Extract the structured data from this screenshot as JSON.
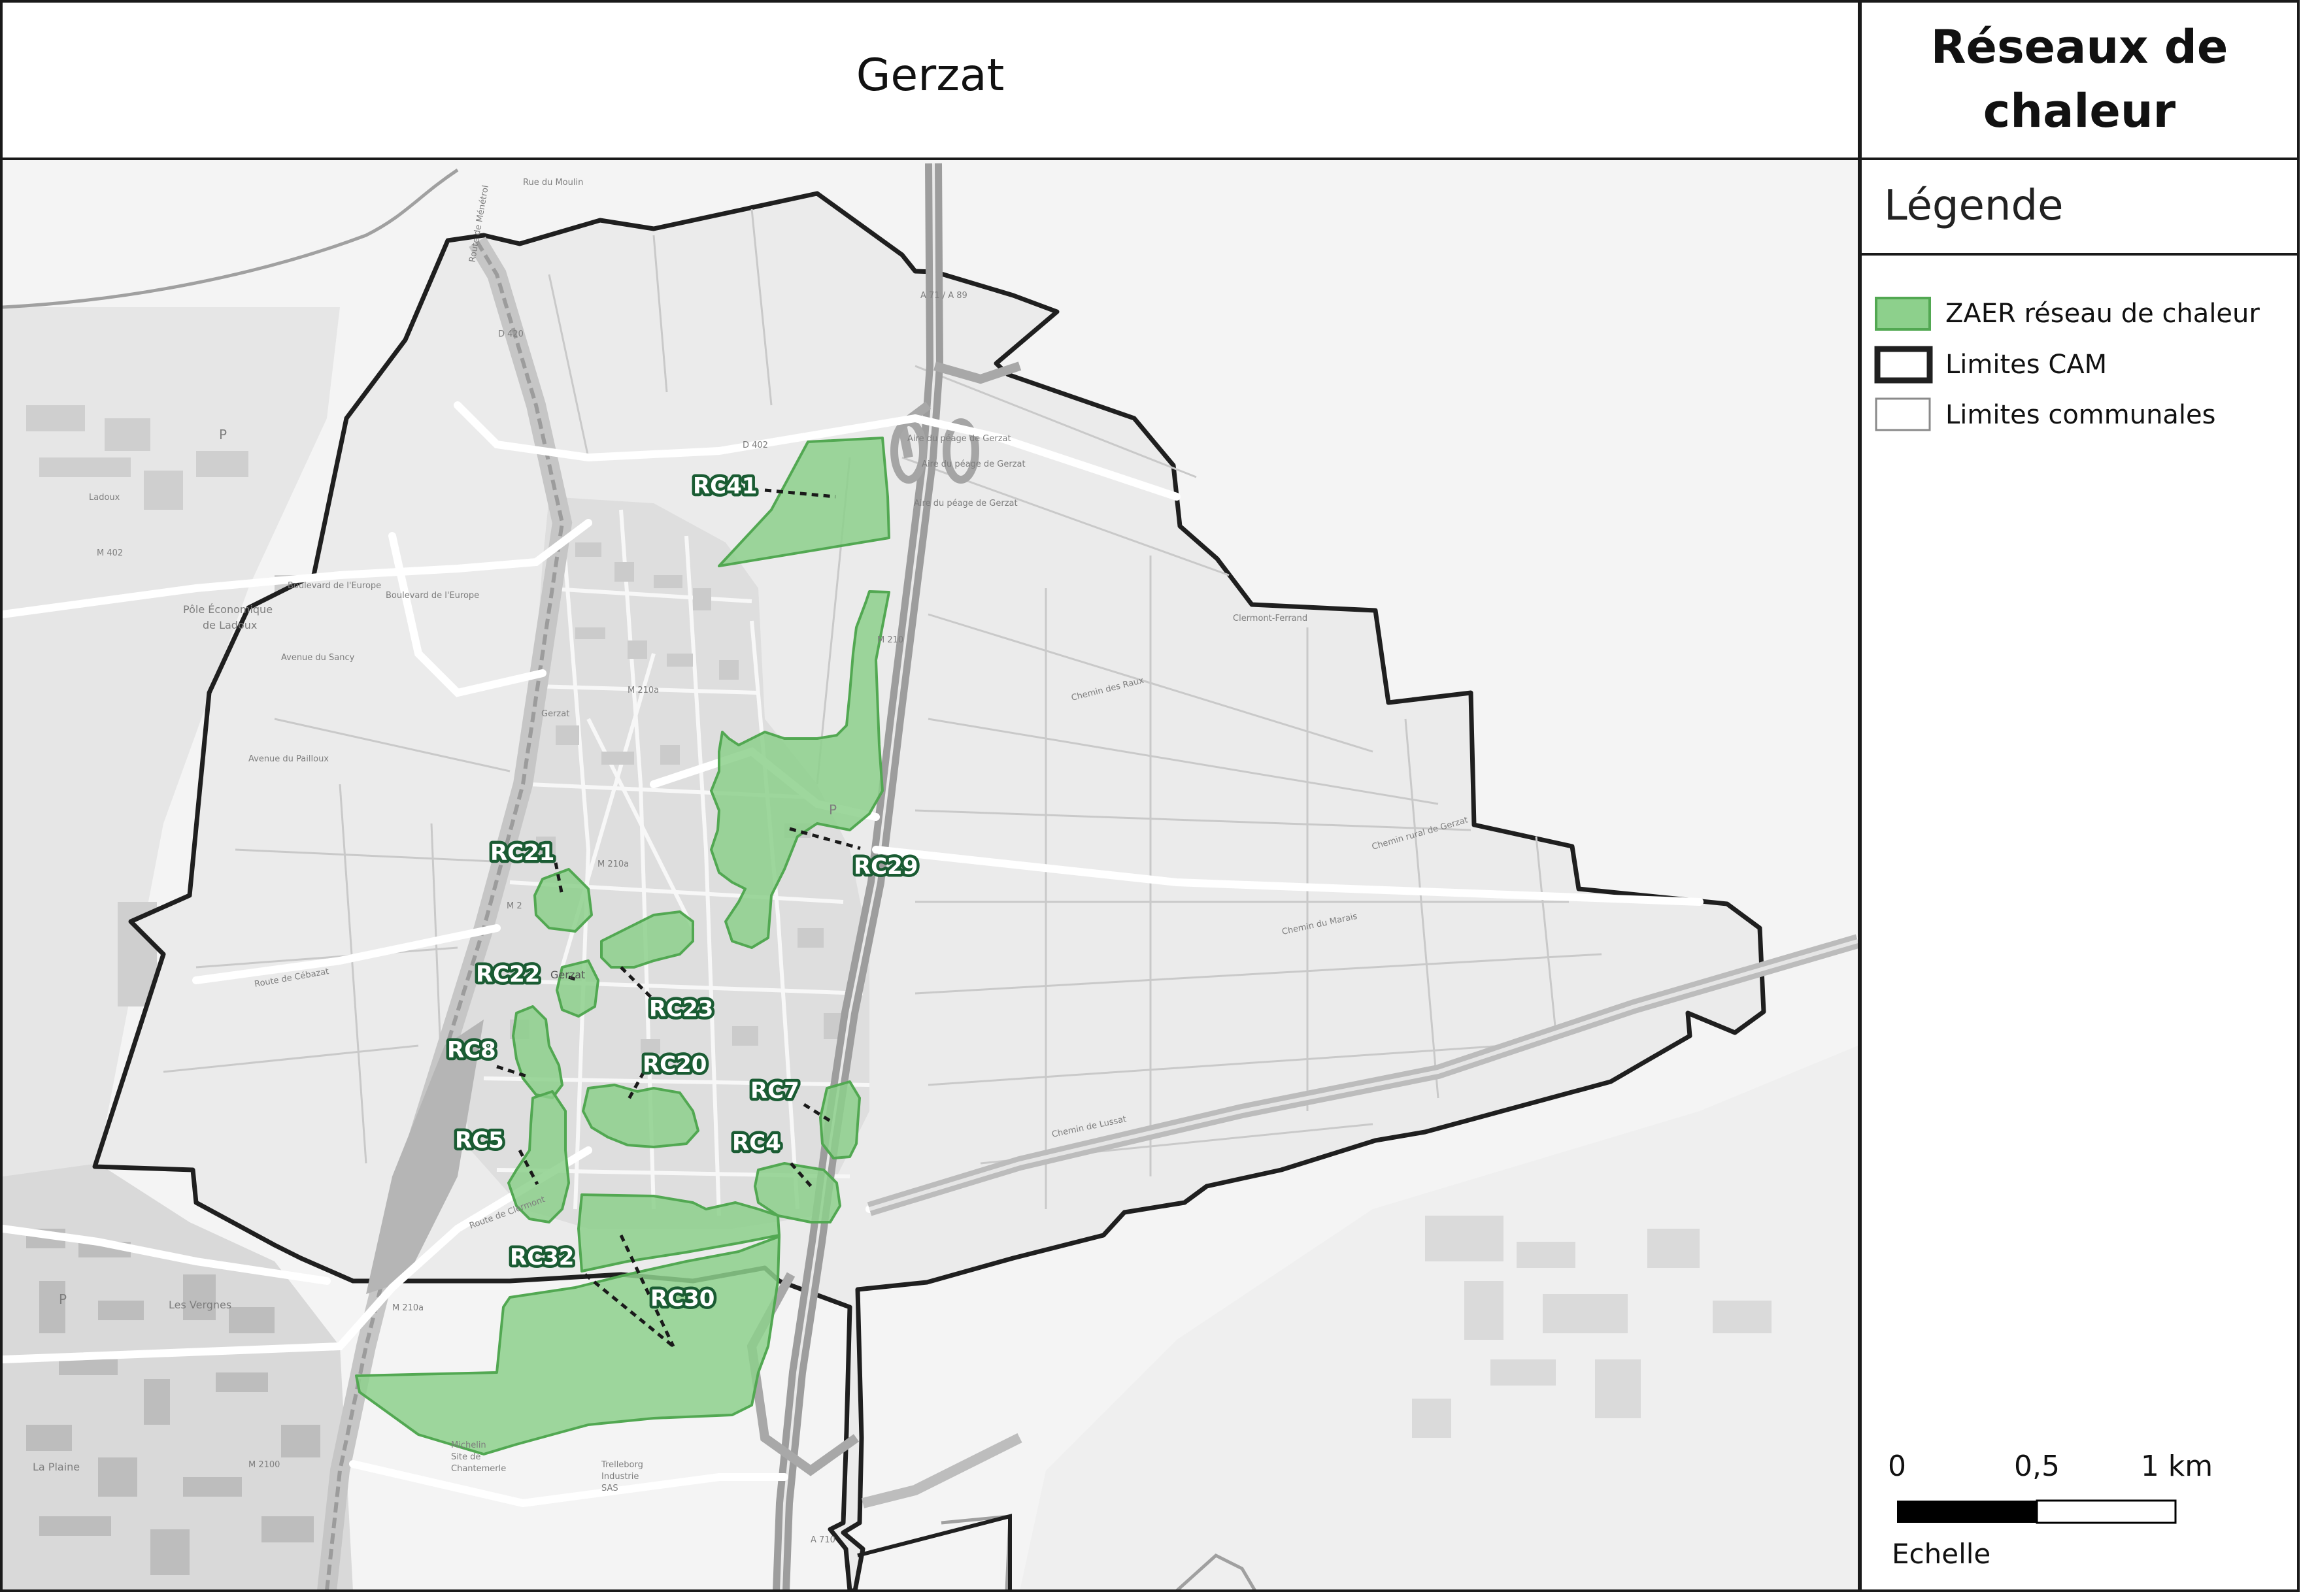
{
  "map_title": "Gerzat",
  "panel": {
    "title_line1": "Réseaux de",
    "title_line2": "chaleur",
    "legend_heading": "Légende",
    "legend": [
      {
        "label": "ZAER réseau de chaleur",
        "fill": "#8dd08c",
        "stroke": "#52a852"
      },
      {
        "label": "Limites CAM",
        "fill": "#ffffff",
        "stroke": "#202020"
      },
      {
        "label": "Limites communales",
        "fill": "#ffffff",
        "stroke": "#8a8a8a"
      }
    ],
    "scale": {
      "tick_0": "0",
      "tick_mid": "0,5",
      "tick_end": "1 km",
      "caption": "Echelle"
    }
  },
  "zone_labels": [
    {
      "id": "rc41",
      "text": "RC41"
    },
    {
      "id": "rc29",
      "text": "RC29"
    },
    {
      "id": "rc21",
      "text": "RC21"
    },
    {
      "id": "rc22",
      "text": "RC22"
    },
    {
      "id": "rc23",
      "text": "RC23"
    },
    {
      "id": "rc8",
      "text": "RC8"
    },
    {
      "id": "rc20",
      "text": "RC20"
    },
    {
      "id": "rc7",
      "text": "RC7"
    },
    {
      "id": "rc5",
      "text": "RC5"
    },
    {
      "id": "rc4",
      "text": "RC4"
    },
    {
      "id": "rc32",
      "text": "RC32"
    },
    {
      "id": "rc30",
      "text": "RC30"
    }
  ],
  "basemap_labels": {
    "rue_moulin": "Rue du Moulin",
    "route_menetrol": "Route de Ménétrol",
    "d420": "D 420",
    "d402": "D 402",
    "a71_a89": "A 71 / A 89",
    "aire_peage1": "Aire du péage de Gerzat",
    "aire_peage2": "Aire du péage de Gerzat",
    "aire_peage3": "Aire du péage de Gerzat",
    "bd_europe1": "Boulevard de l'Europe",
    "bd_europe2": "Boulevard de l'Europe",
    "m402": "M 402",
    "ladoux": "Ladoux",
    "pole_eco": "Pôle Économique",
    "pole_eco2": "de Ladoux",
    "avenue_sancy": "Avenue du Sancy",
    "avenue_pailloux": "Avenue du Pailloux",
    "gerzat_town": "Gerzat",
    "gerzat_center": "Gerzat",
    "m210a": "M 210a",
    "m210": "M 210",
    "m2": "M 2",
    "clermont": "Clermont-Ferrand",
    "chemin_raux": "Chemin des Raux",
    "chemin_gerzat": "Chemin rural de Gerzat",
    "chemin_marais": "Chemin du Marais",
    "chemin_lussat": "Chemin de Lussat",
    "route_cebazat": "Route de Cébazat",
    "route_clermont": "Route de Clermont",
    "les_vergnes": "Les Vergnes",
    "michelin": "Michelin",
    "michelin2": "Site de",
    "michelin3": "Chantemerle",
    "trelleborg": "Trelleborg",
    "trelleborg2": "Industrie",
    "trelleborg3": "SAS",
    "m2100": "M 2100",
    "a710": "A 710",
    "la_plaine": "La Plaine",
    "p_symbol": "P"
  }
}
